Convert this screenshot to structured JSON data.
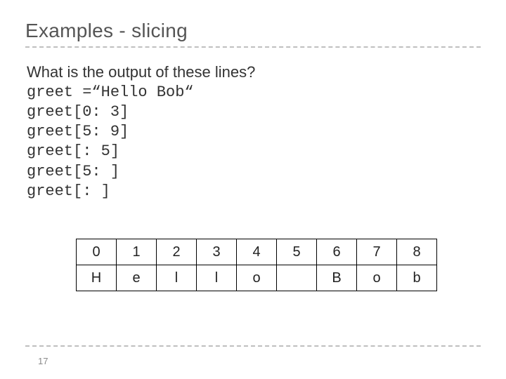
{
  "title": "Examples - slicing",
  "prompt": "What is the output of these lines?",
  "code": {
    "l1": "greet =“Hello Bob“",
    "l2": "greet[0: 3]",
    "l3": "greet[5: 9]",
    "l4": "greet[: 5]",
    "l5": "greet[5: ]",
    "l6": "greet[: ]"
  },
  "chart_data": {
    "type": "table",
    "columns": [
      "0",
      "1",
      "2",
      "3",
      "4",
      "5",
      "6",
      "7",
      "8"
    ],
    "rows": [
      [
        "H",
        "e",
        "l",
        "l",
        "o",
        "",
        "B",
        "o",
        "b"
      ]
    ]
  },
  "page_number": "17"
}
